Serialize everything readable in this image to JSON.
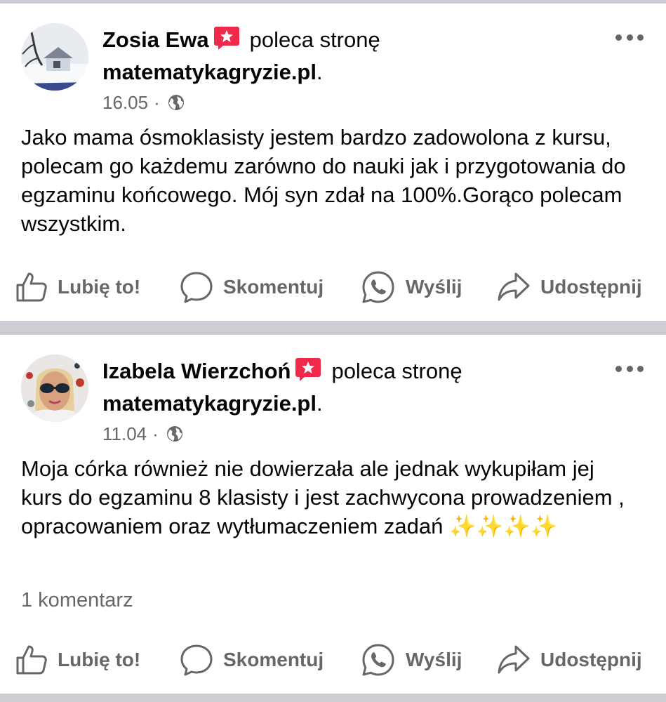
{
  "posts": [
    {
      "author": "Zosia Ewa",
      "recommends_text": "poleca stronę",
      "page": "matematykagryzie.pl",
      "page_suffix": ".",
      "date": "16.05",
      "separator": "·",
      "body": "Jako mama ósmoklasisty jestem bardzo zadowolona z kursu, polecam go każdemu  zarówno do nauki jak i przygotowania do egzaminu końcowego. Mój syn zdał na 100%.Gorąco polecam wszystkim.",
      "comments_count": "",
      "actions": {
        "like": "Lubię to!",
        "comment": "Skomentuj",
        "send": "Wyślij",
        "share": "Udostępnij"
      }
    },
    {
      "author": "Izabela Wierzchoń",
      "recommends_text": "poleca stronę",
      "page": "matematykagryzie.pl",
      "page_suffix": ".",
      "date": "11.04",
      "separator": "·",
      "body": "Moja córka również nie dowierzała ale jednak wykupiłam jej kurs do egzaminu 8 klasisty i jest zachwycona prowadzeniem , opracowaniem oraz wytłumaczeniem zadań ✨✨✨✨",
      "comments_count": "1 komentarz",
      "actions": {
        "like": "Lubię to!",
        "comment": "Skomentuj",
        "send": "Wyślij",
        "share": "Udostępnij"
      }
    }
  ],
  "colors": {
    "badge": "#f02849",
    "secondary_text": "#65676b",
    "divider": "#ccced3"
  },
  "icons": [
    "more-icon",
    "recommend-badge-icon",
    "globe-icon",
    "like-icon",
    "comment-icon",
    "whatsapp-icon",
    "share-icon"
  ]
}
